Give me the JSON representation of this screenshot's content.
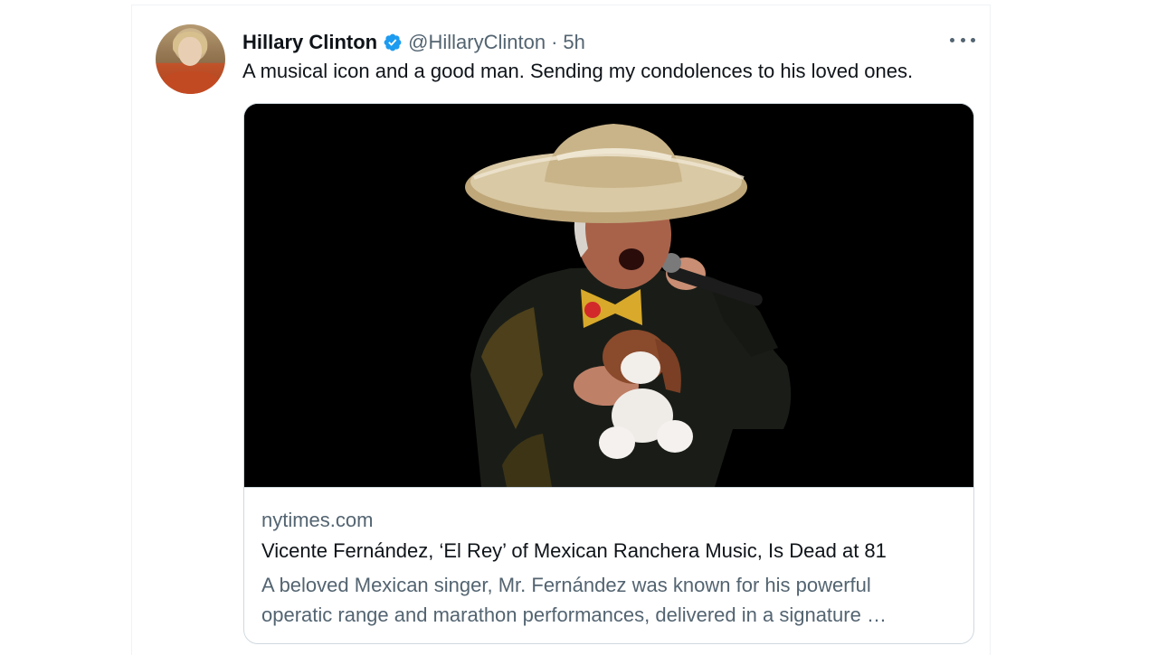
{
  "tweet": {
    "author_name": "Hillary Clinton",
    "handle": "@HillaryClinton",
    "separator": "·",
    "time": "5h",
    "text": "A musical icon and a good man. Sending my condolences to his loved ones.",
    "avatar_icon": "profile-photo",
    "verified_icon": "verified-badge-icon",
    "more_icon": "more-options-icon"
  },
  "card": {
    "image_icon": "singer-photo",
    "domain": "nytimes.com",
    "title": "Vicente Fernández, ‘El Rey’ of Mexican Ranchera Music, Is Dead at 81",
    "description_line1": "A beloved Mexican singer, Mr. Fernández was known for his powerful",
    "description_line2": "operatic range and marathon performances, delivered in a signature …"
  },
  "colors": {
    "text": "#0f1419",
    "secondary_text": "#536471",
    "verified": "#1d9bf0",
    "border": "#cfd9de"
  }
}
